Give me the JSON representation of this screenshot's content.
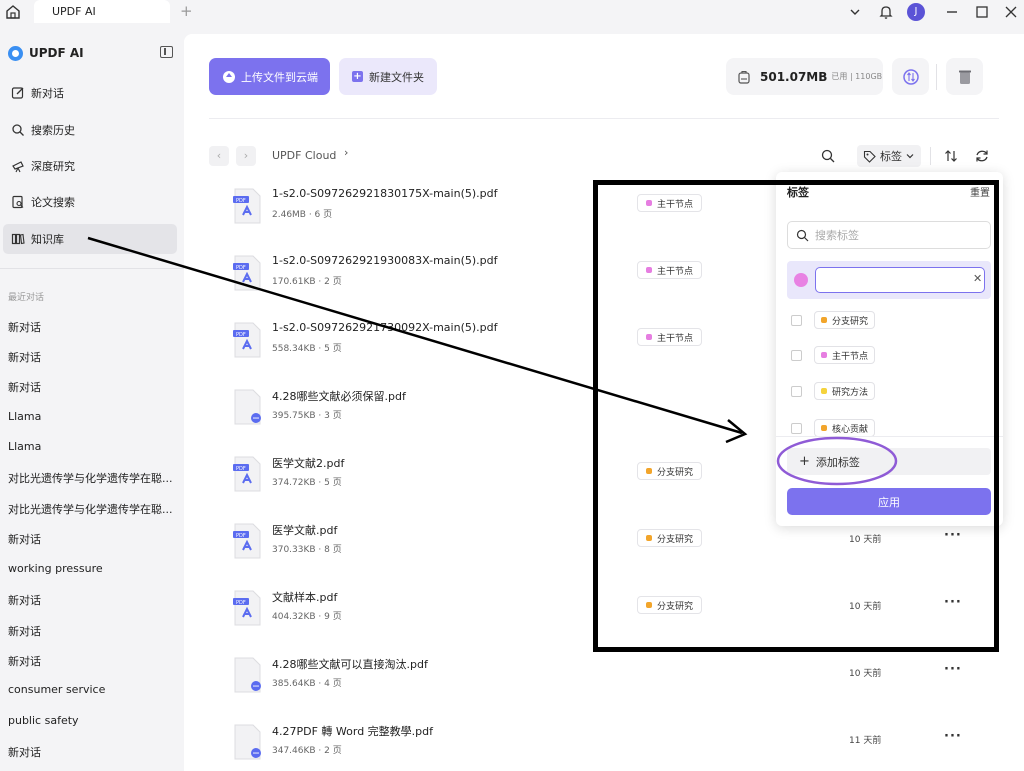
{
  "titlebar": {
    "tab_label": "UPDF AI",
    "tab_add": "+",
    "avatar_letter": "J"
  },
  "sidebar": {
    "brand": "UPDF AI",
    "nav": [
      {
        "label": "新对话",
        "icon": "edit-icon"
      },
      {
        "label": "搜索历史",
        "icon": "search-icon"
      },
      {
        "label": "深度研究",
        "icon": "telescope-icon"
      },
      {
        "label": "论文搜索",
        "icon": "paper-search-icon"
      },
      {
        "label": "知识库",
        "icon": "library-icon",
        "active": true
      }
    ],
    "recent_title": "最近对话",
    "recent": [
      "新对话",
      "新对话",
      "新对话",
      "Llama",
      "Llama",
      "对比光遗传学与化学遗传学在聪...",
      "对比光遗传学与化学遗传学在聪...",
      "新对话",
      "working pressure",
      "新对话",
      "新对话",
      "新对话",
      "consumer service",
      "public safety",
      "新对话"
    ]
  },
  "toolbar": {
    "upload_label": "上传文件到云端",
    "newfolder_label": "新建文件夹",
    "storage_size": "501.07MB",
    "storage_used": "已用 | 110GB"
  },
  "breadcrumb": {
    "prev": "‹",
    "next": "›",
    "path": "UPDF Cloud",
    "chevron": "›"
  },
  "filter": {
    "tag_label": "标签"
  },
  "files": [
    {
      "name": "1-s2.0-S097262921830175X-main(5).pdf",
      "meta": "2.46MB · 6 页",
      "type": "pdf",
      "tag": "主干节点",
      "tag_color": "#e67ee1",
      "time": ""
    },
    {
      "name": "1-s2.0-S097262921930083X-main(5).pdf",
      "meta": "170.61KB · 2 页",
      "type": "pdf",
      "tag": "主干节点",
      "tag_color": "#e67ee1",
      "time": ""
    },
    {
      "name": "1-s2.0-S097262921730092X-main(5).pdf",
      "meta": "558.34KB · 5 页",
      "type": "pdf",
      "tag": "主干节点",
      "tag_color": "#e67ee1",
      "time": ""
    },
    {
      "name": "4.28哪些文献必须保留.pdf",
      "meta": "395.75KB · 3 页",
      "type": "doc",
      "tag": "",
      "tag_color": "",
      "time": ""
    },
    {
      "name": "医学文献2.pdf",
      "meta": "374.72KB · 5 页",
      "type": "pdf",
      "tag": "分支研究",
      "tag_color": "#f2a52b",
      "time": ""
    },
    {
      "name": "医学文献.pdf",
      "meta": "370.33KB · 8 页",
      "type": "pdf",
      "tag": "分支研究",
      "tag_color": "#f2a52b",
      "time": "10 天前"
    },
    {
      "name": "文献样本.pdf",
      "meta": "404.32KB · 9 页",
      "type": "pdf",
      "tag": "分支研究",
      "tag_color": "#f2a52b",
      "time": "10 天前"
    },
    {
      "name": "4.28哪些文献可以直接淘汰.pdf",
      "meta": "385.64KB · 4 页",
      "type": "doc",
      "tag": "",
      "tag_color": "",
      "time": "10 天前"
    },
    {
      "name": "4.27PDF 轉 Word 完整教學.pdf",
      "meta": "347.46KB · 2 页",
      "type": "doc",
      "tag": "",
      "tag_color": "",
      "time": "11 天前"
    }
  ],
  "more_glyph": "···",
  "tag_popup": {
    "title": "标签",
    "reset": "重置",
    "search_placeholder": "搜索标签",
    "new_tag_value": "",
    "clear_glyph": "✕",
    "options": [
      {
        "label": "分支研究",
        "color": "#f2a52b"
      },
      {
        "label": "主干节点",
        "color": "#e67ee1"
      },
      {
        "label": "研究方法",
        "color": "#f5d33c"
      },
      {
        "label": "核心贡献",
        "color": "#f2a52b"
      }
    ],
    "add_label": "添加标签",
    "apply_label": "应用"
  },
  "colors": {
    "accent": "#7c72ee",
    "annotation_circle": "#8f5bd6"
  }
}
